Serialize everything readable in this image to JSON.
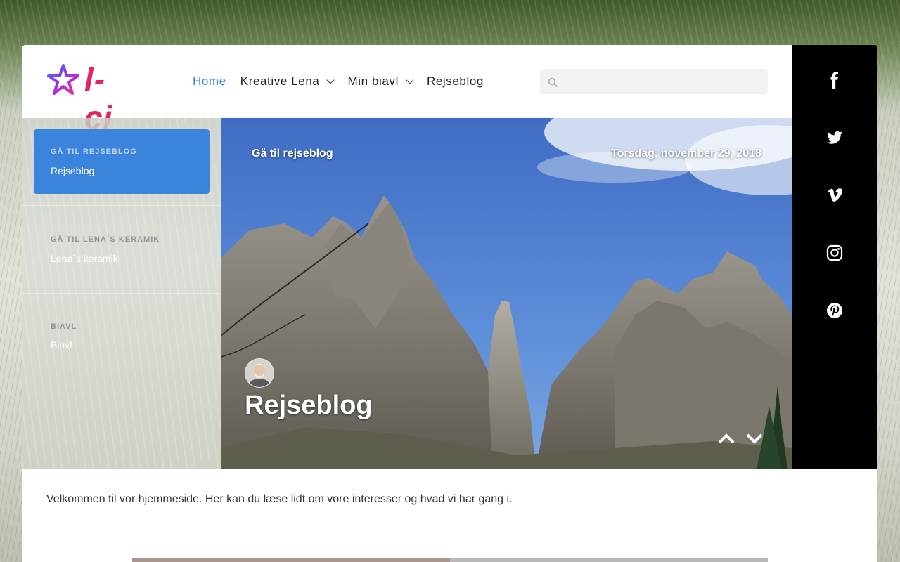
{
  "header": {
    "logo_text": "l-cj",
    "nav": [
      {
        "label": "Home",
        "active": true,
        "dropdown": false
      },
      {
        "label": "Kreative Lena",
        "active": false,
        "dropdown": true
      },
      {
        "label": "Min biavl",
        "active": false,
        "dropdown": true
      },
      {
        "label": "Rejseblog",
        "active": false,
        "dropdown": false
      }
    ],
    "search": {
      "placeholder": "",
      "value": "",
      "icon": "search-icon"
    }
  },
  "sidebar": {
    "items": [
      {
        "label": "GÅ TIL REJSEBLOG",
        "link": "Rejseblog",
        "active": true
      },
      {
        "label": "GÅ TIL LENA´S KERAMIK",
        "link": "Lena´s keramik",
        "active": false
      },
      {
        "label": "BIAVL",
        "link": "Biavl",
        "active": false
      }
    ]
  },
  "hero": {
    "goto": "Gå til rejseblog",
    "date": "Torsdag, november 29, 2018",
    "title": "Rejseblog"
  },
  "social": [
    "facebook-icon",
    "twitter-icon",
    "vimeo-icon",
    "instagram-icon",
    "pinterest-icon"
  ],
  "content": {
    "intro": "Velkommen til vor hjemmeside. Her kan du læse lidt om vore interesser og hvad vi har gang i."
  },
  "colors": {
    "accent": "#3a84dd",
    "logo_pink": "#e3245f",
    "social_bg": "#000000"
  }
}
